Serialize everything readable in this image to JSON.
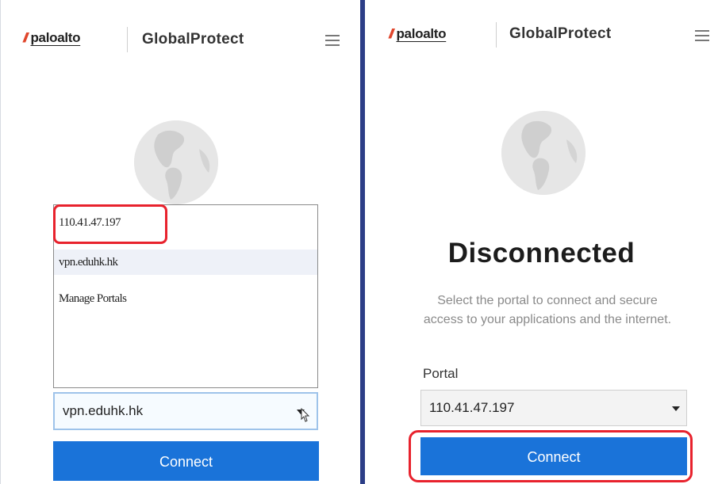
{
  "left": {
    "brand": "paloalto",
    "product": "GlobalProtect",
    "portal_options": [
      "110.41.47.197",
      "vpn.eduhk.hk",
      "Manage Portals"
    ],
    "selected_portal": "vpn.eduhk.hk",
    "connect_label": "Connect"
  },
  "right": {
    "brand": "paloalto",
    "product": "GlobalProtect",
    "status_title": "Disconnected",
    "status_message": "Select the portal to connect and secure access to your applications and the internet.",
    "portal_label": "Portal",
    "selected_portal": "110.41.47.197",
    "connect_label": "Connect"
  },
  "colors": {
    "accent": "#1a73d9",
    "brand": "#e0452b",
    "highlight": "#e8222d",
    "divider": "#2c3e87"
  },
  "icons": [
    "paloalto-logo-icon",
    "hamburger-menu-icon",
    "globe-icon",
    "dropdown-caret-icon",
    "mouse-cursor-icon"
  ]
}
